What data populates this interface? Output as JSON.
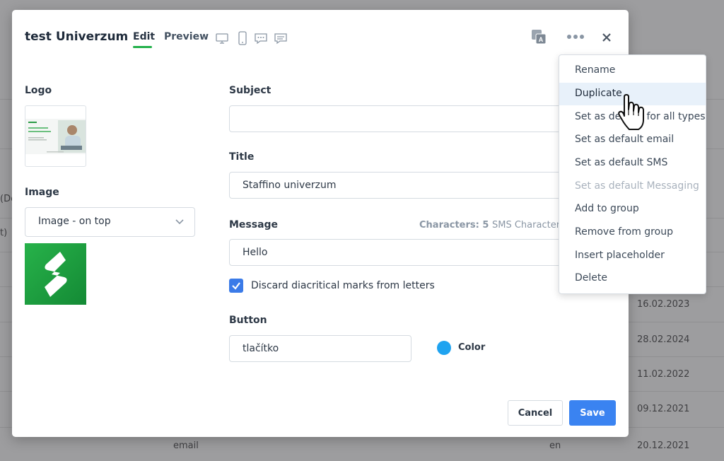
{
  "background": {
    "rows": [
      {
        "left": "",
        "mid": "",
        "right": "16.02.2023"
      },
      {
        "left": "",
        "mid": "",
        "right": "28.02.2024"
      },
      {
        "left": "",
        "mid": "",
        "right": "11.02.2022"
      },
      {
        "left": "",
        "mid": "",
        "right": "09.12.2021"
      },
      {
        "left": "email",
        "mid": "en",
        "right": "20.12.2021"
      }
    ],
    "edge_fragments": [
      "(De",
      "t)"
    ]
  },
  "modal": {
    "title": "test Univerzum",
    "tabs": [
      {
        "label": "Edit",
        "active": true
      },
      {
        "label": "Preview",
        "active": false
      }
    ],
    "device_icons": [
      "desktop-icon",
      "mobile-icon",
      "chat-bubble-icon",
      "message-icon"
    ],
    "header_icons": [
      "translate-icon",
      "more-icon",
      "close-icon"
    ]
  },
  "left_panel": {
    "logo_label": "Logo",
    "image_label": "Image",
    "image_position_select": "Image - on top"
  },
  "form": {
    "subject_label": "Subject",
    "subject_value": "",
    "title_label": "Title",
    "title_value": "Staffino univerzum",
    "message_label": "Message",
    "characters_text": "Characters: 5",
    "sms_characters_text": "SMS Character",
    "message_value": "Hello",
    "discard_diacritics_label": "Discard diacritical marks from letters",
    "discard_diacritics_checked": true,
    "button_label": "Button",
    "button_value": "tlačítko",
    "color_label": "Color",
    "color_value": "#1fa3f0"
  },
  "footer": {
    "cancel_label": "Cancel",
    "save_label": "Save",
    "save_color": "#3a83f1"
  },
  "menu": {
    "items": [
      {
        "label": "Rename",
        "state": "normal"
      },
      {
        "label": "Duplicate",
        "state": "hover"
      },
      {
        "label": "Set as default for all types",
        "state": "normal"
      },
      {
        "label": "Set as default email",
        "state": "normal"
      },
      {
        "label": "Set as default SMS",
        "state": "normal"
      },
      {
        "label": "Set as default Messaging",
        "state": "disabled"
      },
      {
        "label": "Add to group",
        "state": "normal"
      },
      {
        "label": "Remove from group",
        "state": "normal"
      },
      {
        "label": "Insert placeholder",
        "state": "normal"
      },
      {
        "label": "Delete",
        "state": "normal"
      }
    ]
  },
  "accent_colors": {
    "tab_underline": "#22b04a",
    "checkbox": "#3b7be8",
    "logo_green": "#1d9a3c"
  }
}
